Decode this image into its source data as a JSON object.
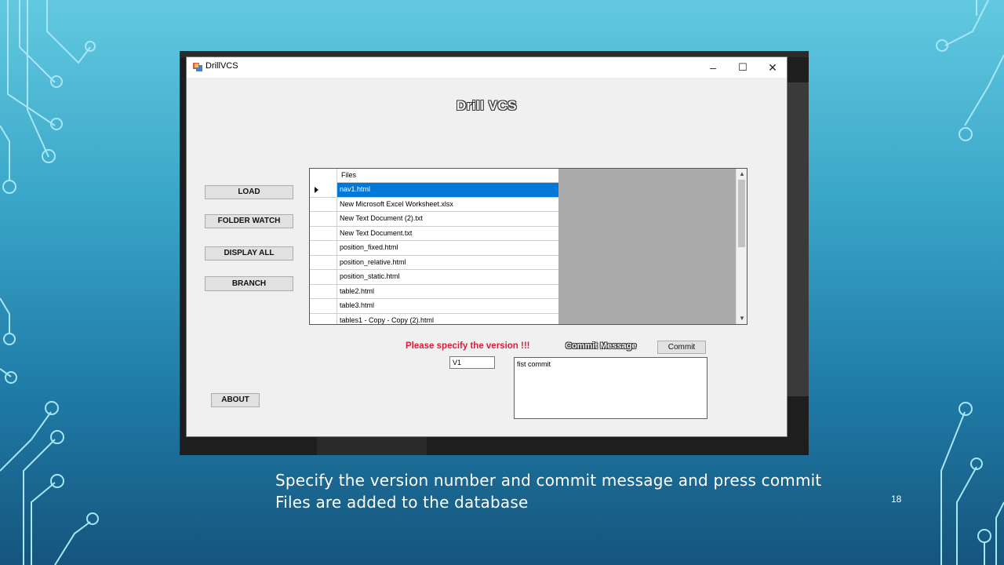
{
  "window": {
    "title": "DrillVCS",
    "controls": {
      "minimize": "–",
      "maximize": "☐",
      "close": "✕"
    }
  },
  "app": {
    "heading": "Drill VCS",
    "buttons": {
      "load": "LOAD",
      "folder_watch": "FOLDER WATCH",
      "display_all": "DISPLAY ALL",
      "branch": "BRANCH",
      "about": "ABOUT",
      "commit": "Commit"
    },
    "grid": {
      "header": "Files",
      "rows": [
        "nav1.html",
        "New Microsoft Excel Worksheet.xlsx",
        "New Text Document (2).txt",
        "New Text Document.txt",
        "position_fixed.html",
        "position_relative.html",
        "position_static.html",
        "table2.html",
        "table3.html",
        "tables1 - Copy - Copy (2).html"
      ],
      "selected_index": 0
    },
    "warning": "Please specify the version !!!",
    "commit_message_label": "Commit Message",
    "version_value": "V1",
    "commit_message_value": "fist commit"
  },
  "slide": {
    "caption_line1": "Specify the version number and commit message and press commit",
    "caption_line2": "Files are added to the database",
    "number": "18"
  },
  "colors": {
    "selection": "#0078d7",
    "warning": "#d81e3c",
    "circuit": "#9fe3f2"
  }
}
